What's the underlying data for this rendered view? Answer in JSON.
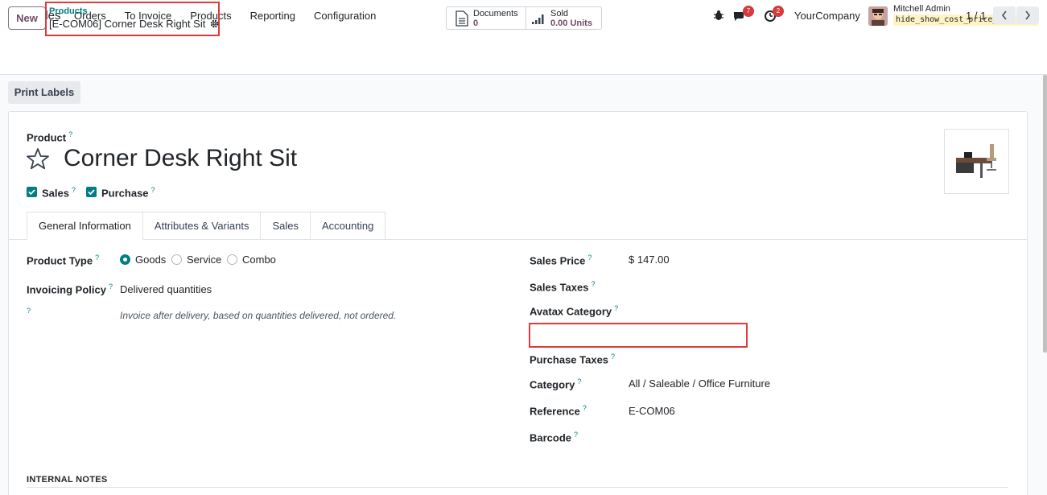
{
  "navbar": {
    "app_name": "Sales",
    "menu": [
      "Orders",
      "To Invoice",
      "Products",
      "Reporting",
      "Configuration"
    ],
    "messages_count": "7",
    "activities_count": "2",
    "company": "YourCompany",
    "user_name": "Mitchell Admin",
    "db_name": "hide_show_cost_price_knk..."
  },
  "control_panel": {
    "new_label": "New",
    "breadcrumb_parent": "Products",
    "breadcrumb_current": "[E-COM06] Corner Desk Right Sit",
    "documents_label": "Documents",
    "documents_value": "0",
    "sold_label": "Sold",
    "sold_value": "0.00 Units",
    "pager": "1 / 1"
  },
  "actions": {
    "print_labels": "Print Labels"
  },
  "form": {
    "product_label": "Product",
    "product_name": "Corner Desk Right Sit",
    "sales_label": "Sales",
    "purchase_label": "Purchase",
    "tabs": [
      "General Information",
      "Attributes & Variants",
      "Sales",
      "Accounting"
    ],
    "product_type_label": "Product Type",
    "product_type_options": [
      "Goods",
      "Service",
      "Combo"
    ],
    "invoicing_policy_label": "Invoicing Policy",
    "invoicing_policy_value": "Delivered quantities",
    "invoicing_help": "Invoice after delivery, based on quantities delivered, not ordered.",
    "sales_price_label": "Sales Price",
    "sales_price_value": "$ 147.00",
    "sales_taxes_label": "Sales Taxes",
    "avatax_label": "Avatax Category",
    "purchase_taxes_label": "Purchase Taxes",
    "category_label": "Category",
    "category_value": "All / Saleable / Office Furniture",
    "reference_label": "Reference",
    "reference_value": "E-COM06",
    "barcode_label": "Barcode",
    "internal_notes_label": "INTERNAL NOTES",
    "help_mark": "?"
  },
  "colors": {
    "primary": "#714b67",
    "accent": "#017e84",
    "highlight": "#e03a3a"
  },
  "icons": [
    "app-logo-icon",
    "bug-icon",
    "chat-icon",
    "clock-icon",
    "gear-icon",
    "document-icon",
    "bar-chart-icon",
    "star-icon",
    "chevron-left-icon",
    "chevron-right-icon"
  ]
}
